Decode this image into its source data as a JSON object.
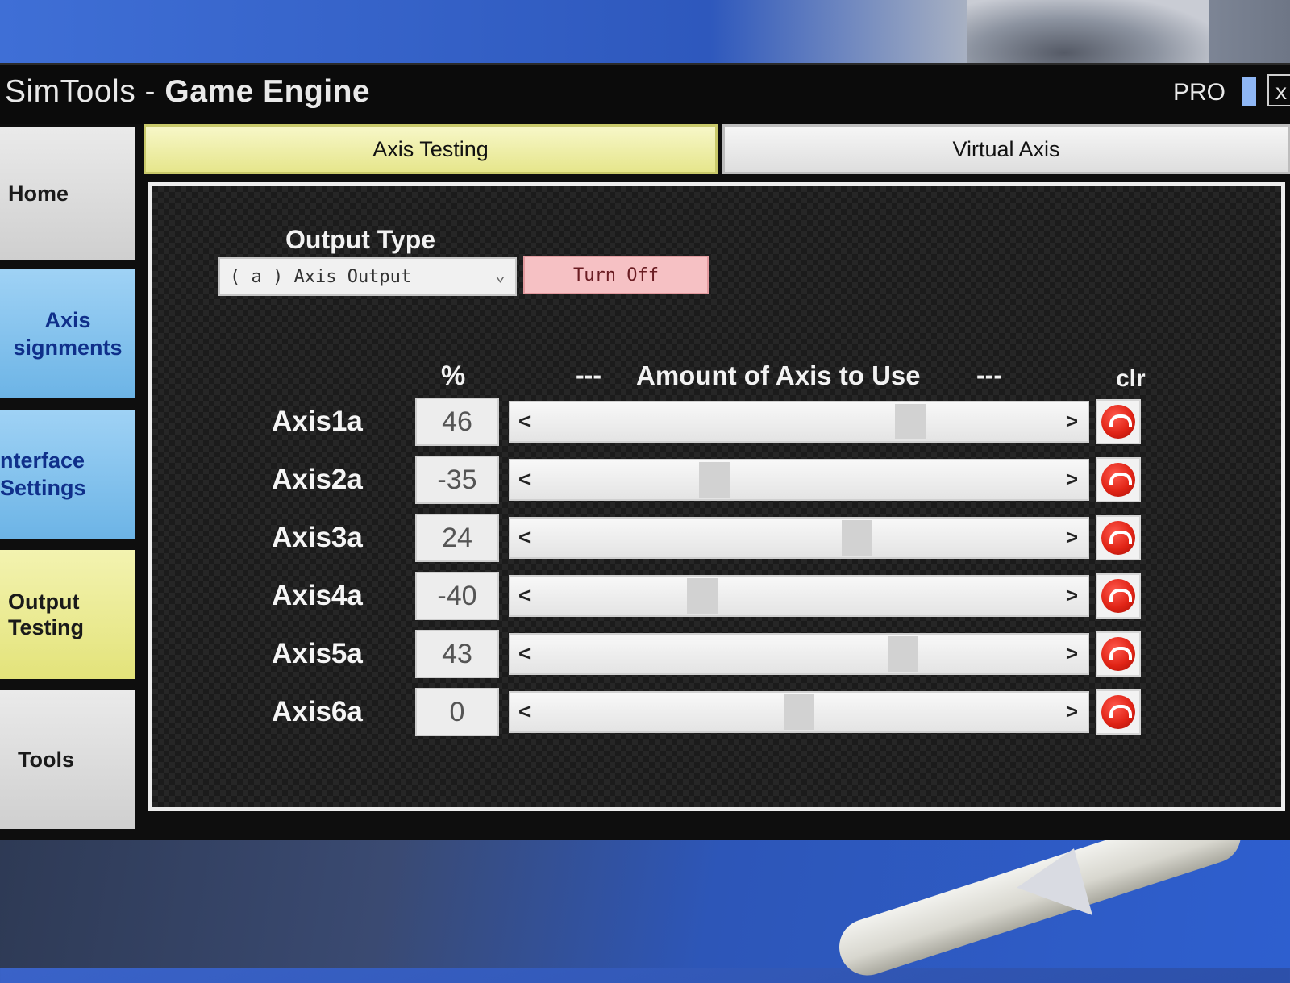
{
  "window": {
    "title_light": "SimTools - ",
    "title_bold": "Game Engine",
    "edition": "PRO",
    "close_glyph": "x"
  },
  "nav": {
    "home": "Home",
    "axis_assignments_line1": "Axis",
    "axis_assignments_line2": "signments",
    "interface_settings_line1": "nterface",
    "interface_settings_line2": "Settings",
    "output_testing_line1": "Output",
    "output_testing_line2": "Testing",
    "tools": "Tools"
  },
  "tabs": {
    "axis_testing": "Axis Testing",
    "virtual_axis": "Virtual Axis"
  },
  "output": {
    "label": "Output Type",
    "selected": "( a ) Axis Output",
    "turn_off": "Turn Off"
  },
  "table": {
    "pct_header": "%",
    "dash": "---",
    "amount_header": "Amount of Axis to Use",
    "clr_header": "clr"
  },
  "axes": [
    {
      "label": "Axis1a",
      "value": "46",
      "percent": 46
    },
    {
      "label": "Axis2a",
      "value": "-35",
      "percent": -35
    },
    {
      "label": "Axis3a",
      "value": "24",
      "percent": 24
    },
    {
      "label": "Axis4a",
      "value": "-40",
      "percent": -40
    },
    {
      "label": "Axis5a",
      "value": "43",
      "percent": 43
    },
    {
      "label": "Axis6a",
      "value": "0",
      "percent": 0
    }
  ],
  "colors": {
    "active_tab": "#e6e68c",
    "nav_blue": "#6cb4e6",
    "turn_off": "#f6c1c4",
    "clr_red": "#e12416"
  }
}
